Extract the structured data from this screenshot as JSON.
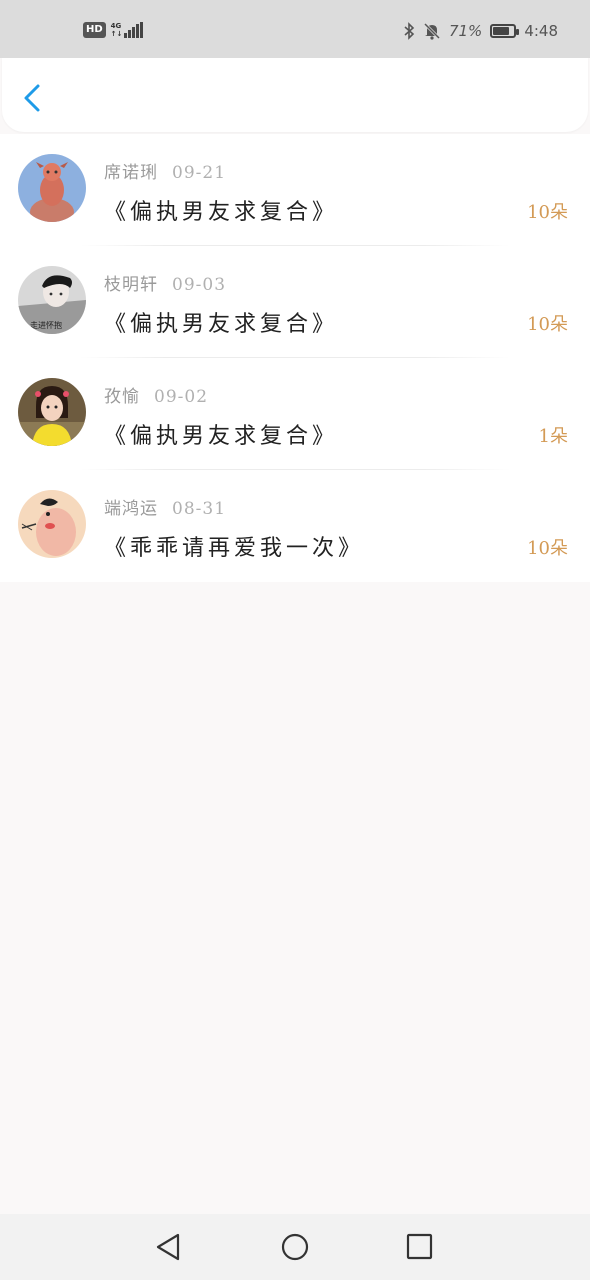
{
  "status_bar": {
    "hd_label": "HD",
    "network_top": "4G",
    "network_bottom": "↑↓",
    "battery_percent": "71%",
    "time": "4:48",
    "icons": [
      "bluetooth-icon",
      "mute-icon",
      "battery-icon"
    ]
  },
  "header": {
    "back_icon": "chevron-left-icon",
    "accent_color": "#1e9be8"
  },
  "gifts": [
    {
      "name": "席诺琍",
      "date": "09-21",
      "title": "《偏执男友求复合》",
      "count": "10朵"
    },
    {
      "name": "枝明轩",
      "date": "09-03",
      "title": "《偏执男友求复合》",
      "count": "10朵",
      "avatar_caption": "走进怀抱"
    },
    {
      "name": "孜愉",
      "date": "09-02",
      "title": "《偏执男友求复合》",
      "count": "1朵"
    },
    {
      "name": "端鸿运",
      "date": "08-31",
      "title": "《乖乖请再爱我一次》",
      "count": "10朵"
    }
  ],
  "colors": {
    "count": "#d39a55",
    "background": "#faf8f8"
  },
  "nav": [
    "back-triangle-icon",
    "home-circle-icon",
    "recents-square-icon"
  ]
}
